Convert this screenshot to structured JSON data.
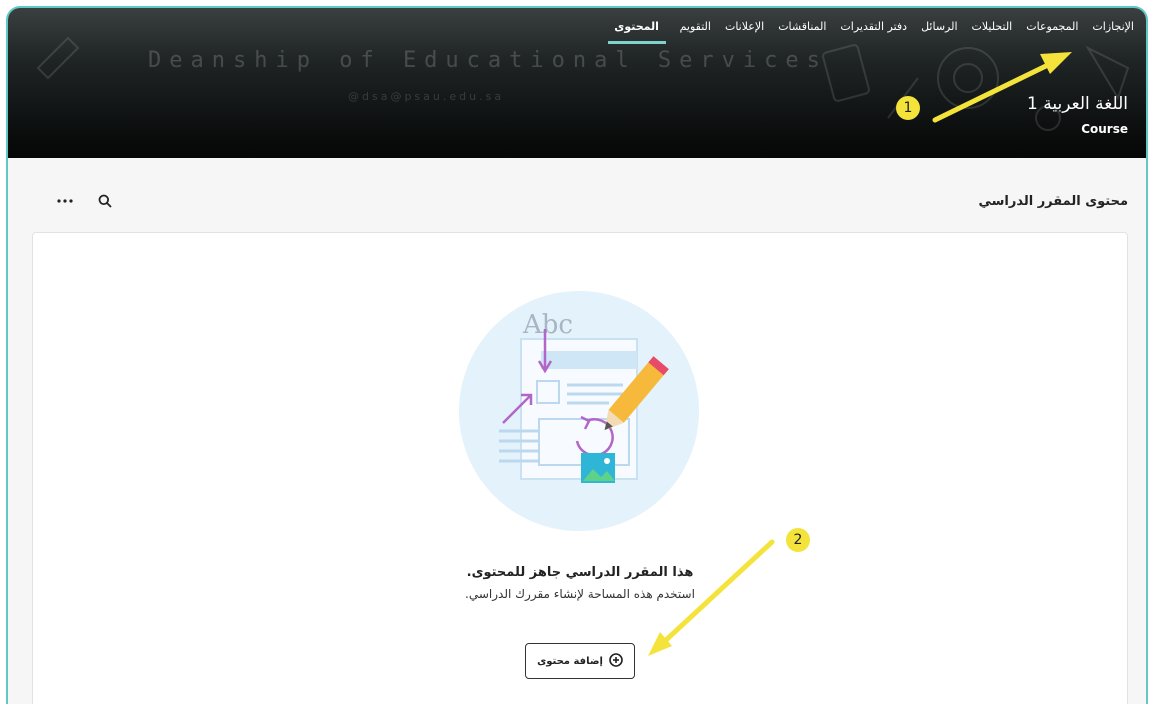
{
  "banner": {
    "title": "Deanship of Educational Services",
    "email": "@dsa@psau.edu.sa"
  },
  "nav": {
    "items": [
      "المحتوى",
      "التقويم",
      "الإعلانات",
      "المناقشات",
      "دفتر التقديرات",
      "الرسائل",
      "التحليلات",
      "المجموعات",
      "الإنجازات"
    ],
    "active_index": 0
  },
  "course": {
    "name": "اللغة العربية 1",
    "type": "Course"
  },
  "content": {
    "section_title": "محتوى المقرر الدراسي",
    "empty_title": "هذا المقرر الدراسي جاهز للمحتوى.",
    "empty_description": "استخدم هذه المساحة لإنشاء مقررك الدراسي.",
    "add_button_label": "إضافة محتوى",
    "illustration_text": "Abc"
  },
  "annotations": {
    "badge1": "1",
    "badge2": "2",
    "color": "#f3e33a"
  },
  "icons": [
    "search-icon",
    "more-icon",
    "plus-circle-icon",
    "arrow-icon"
  ]
}
